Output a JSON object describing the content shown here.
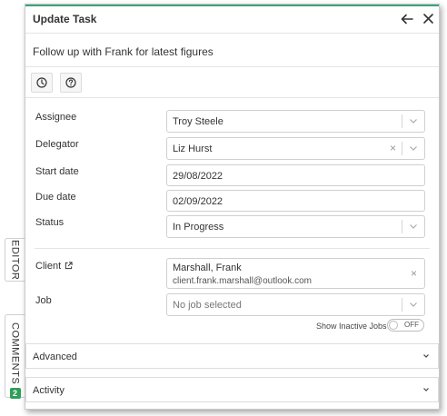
{
  "panel": {
    "title": "Update Task",
    "subject": "Follow up with Frank for latest figures"
  },
  "header_icons": {
    "back": "arrow-left-icon",
    "close": "close-icon"
  },
  "toolbar": [
    {
      "name": "clock-icon"
    },
    {
      "name": "help-icon"
    }
  ],
  "form": {
    "assignee": {
      "label": "Assignee",
      "value": "Troy Steele"
    },
    "delegator": {
      "label": "Delegator",
      "value": "Liz Hurst"
    },
    "start_date": {
      "label": "Start date",
      "value": "29/08/2022"
    },
    "due_date": {
      "label": "Due date",
      "value": "02/09/2022"
    },
    "status": {
      "label": "Status",
      "value": "In Progress"
    },
    "client": {
      "label": "Client",
      "name": "Marshall, Frank",
      "email": "client.frank.marshall@outlook.com"
    },
    "job": {
      "label": "Job",
      "placeholder": "No job selected"
    },
    "show_inactive": {
      "label": "Show Inactive Jobs",
      "state": "OFF"
    }
  },
  "sections": {
    "advanced": "Advanced",
    "activity": "Activity"
  },
  "side_tabs": {
    "editor": "EDITOR",
    "comments": "COMMENTS",
    "comments_count": "2"
  },
  "colors": {
    "accent": "#3aa37a",
    "badge": "#2e9e5a"
  }
}
